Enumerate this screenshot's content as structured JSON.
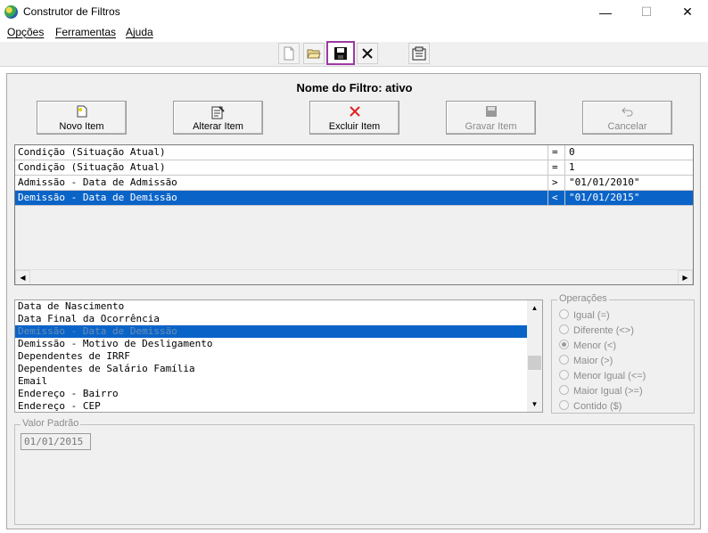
{
  "window": {
    "title": "Construtor de Filtros",
    "min_glyph": "—",
    "max_glyph": "☐",
    "close_glyph": "✕"
  },
  "menu": [
    "Opções",
    "Ferramentas",
    "Ajuda"
  ],
  "toolbar": {
    "icons": [
      "new-file-icon",
      "open-folder-icon",
      "save-icon",
      "delete-x-icon",
      "properties-icon"
    ]
  },
  "filter_name": "Nome do Filtro: ativo",
  "actions": [
    {
      "label": "Novo Item",
      "icon": "new-item-icon",
      "enabled": true
    },
    {
      "label": "Alterar Item",
      "icon": "edit-item-icon",
      "enabled": true
    },
    {
      "label": "Excluir Item",
      "icon": "delete-item-icon",
      "enabled": true
    },
    {
      "label": "Gravar Item",
      "icon": "save-item-icon",
      "enabled": false
    },
    {
      "label": "Cancelar",
      "icon": "undo-icon",
      "enabled": false
    }
  ],
  "grid_rows": [
    {
      "field": "Condição (Situação Atual)",
      "op": "=",
      "value": "0",
      "selected": false
    },
    {
      "field": "Condição (Situação Atual)",
      "op": "=",
      "value": "1",
      "selected": false
    },
    {
      "field": "Admissão - Data de Admissão",
      "op": ">",
      "value": "\"01/01/2010\"",
      "selected": false
    },
    {
      "field": "Demissão - Data de Demissão",
      "op": "<",
      "value": "\"01/01/2015\"",
      "selected": true
    }
  ],
  "fields_list": [
    {
      "label": "Data de Nascimento",
      "selected": false
    },
    {
      "label": "Data Final da Ocorrência",
      "selected": false
    },
    {
      "label": "Demissão - Data de Demissão",
      "selected": true
    },
    {
      "label": "Demissão - Motivo de Desligamento",
      "selected": false
    },
    {
      "label": "Dependentes de IRRF",
      "selected": false
    },
    {
      "label": "Dependentes de Salário Família",
      "selected": false
    },
    {
      "label": "Email",
      "selected": false
    },
    {
      "label": "Endereço - Bairro",
      "selected": false
    },
    {
      "label": "Endereço - CEP",
      "selected": false
    }
  ],
  "operations": {
    "title": "Operações",
    "options": [
      {
        "label": "Igual (=)",
        "checked": false
      },
      {
        "label": "Diferente (<>)",
        "checked": false
      },
      {
        "label": "Menor (<)",
        "checked": true
      },
      {
        "label": "Maior  (>)",
        "checked": false
      },
      {
        "label": "Menor Igual (<=)",
        "checked": false
      },
      {
        "label": "Maior Igual (>=)",
        "checked": false
      },
      {
        "label": "Contido ($)",
        "checked": false
      }
    ]
  },
  "default_value": {
    "title": "Valor Padrão",
    "value": "01/01/2015"
  },
  "colors": {
    "selection": "#0a64c8",
    "highlight_border": "#9b3aa3"
  }
}
